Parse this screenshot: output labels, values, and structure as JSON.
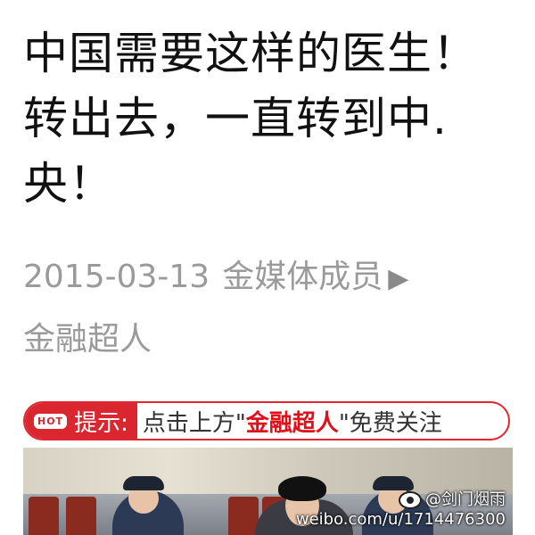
{
  "article": {
    "title": "中国需要这样的医生！转出去，一直转到中.央！",
    "date": "2015-03-13",
    "source": "金媒体成员",
    "arrow": "▶",
    "author": "金融超人"
  },
  "tip": {
    "hot_badge": "HOT",
    "label": "提示:",
    "text_before": "点击上方\"",
    "account_name": "金融超人",
    "text_after": "\"免费关注"
  },
  "watermark": {
    "user": "@剑门烟雨",
    "url": "weibo.com/u/1714476300",
    "icon": "weibo-icon"
  },
  "colors": {
    "accent": "#d9262f",
    "meta_gray": "#9a9a9a",
    "title": "#111111"
  }
}
